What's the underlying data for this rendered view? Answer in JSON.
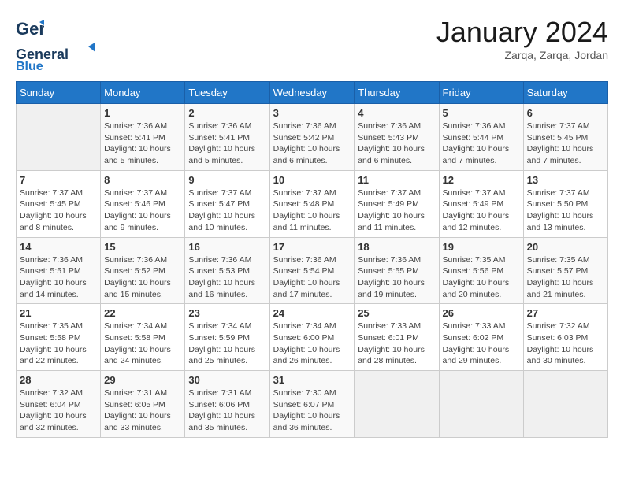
{
  "header": {
    "logo_line1": "General",
    "logo_line2": "Blue",
    "month_title": "January 2024",
    "location": "Zarqa, Zarqa, Jordan"
  },
  "weekdays": [
    "Sunday",
    "Monday",
    "Tuesday",
    "Wednesday",
    "Thursday",
    "Friday",
    "Saturday"
  ],
  "weeks": [
    [
      {
        "day": "",
        "info": ""
      },
      {
        "day": "1",
        "info": "Sunrise: 7:36 AM\nSunset: 5:41 PM\nDaylight: 10 hours\nand 5 minutes."
      },
      {
        "day": "2",
        "info": "Sunrise: 7:36 AM\nSunset: 5:41 PM\nDaylight: 10 hours\nand 5 minutes."
      },
      {
        "day": "3",
        "info": "Sunrise: 7:36 AM\nSunset: 5:42 PM\nDaylight: 10 hours\nand 6 minutes."
      },
      {
        "day": "4",
        "info": "Sunrise: 7:36 AM\nSunset: 5:43 PM\nDaylight: 10 hours\nand 6 minutes."
      },
      {
        "day": "5",
        "info": "Sunrise: 7:36 AM\nSunset: 5:44 PM\nDaylight: 10 hours\nand 7 minutes."
      },
      {
        "day": "6",
        "info": "Sunrise: 7:37 AM\nSunset: 5:45 PM\nDaylight: 10 hours\nand 7 minutes."
      }
    ],
    [
      {
        "day": "7",
        "info": "Sunrise: 7:37 AM\nSunset: 5:45 PM\nDaylight: 10 hours\nand 8 minutes."
      },
      {
        "day": "8",
        "info": "Sunrise: 7:37 AM\nSunset: 5:46 PM\nDaylight: 10 hours\nand 9 minutes."
      },
      {
        "day": "9",
        "info": "Sunrise: 7:37 AM\nSunset: 5:47 PM\nDaylight: 10 hours\nand 10 minutes."
      },
      {
        "day": "10",
        "info": "Sunrise: 7:37 AM\nSunset: 5:48 PM\nDaylight: 10 hours\nand 11 minutes."
      },
      {
        "day": "11",
        "info": "Sunrise: 7:37 AM\nSunset: 5:49 PM\nDaylight: 10 hours\nand 11 minutes."
      },
      {
        "day": "12",
        "info": "Sunrise: 7:37 AM\nSunset: 5:49 PM\nDaylight: 10 hours\nand 12 minutes."
      },
      {
        "day": "13",
        "info": "Sunrise: 7:37 AM\nSunset: 5:50 PM\nDaylight: 10 hours\nand 13 minutes."
      }
    ],
    [
      {
        "day": "14",
        "info": "Sunrise: 7:36 AM\nSunset: 5:51 PM\nDaylight: 10 hours\nand 14 minutes."
      },
      {
        "day": "15",
        "info": "Sunrise: 7:36 AM\nSunset: 5:52 PM\nDaylight: 10 hours\nand 15 minutes."
      },
      {
        "day": "16",
        "info": "Sunrise: 7:36 AM\nSunset: 5:53 PM\nDaylight: 10 hours\nand 16 minutes."
      },
      {
        "day": "17",
        "info": "Sunrise: 7:36 AM\nSunset: 5:54 PM\nDaylight: 10 hours\nand 17 minutes."
      },
      {
        "day": "18",
        "info": "Sunrise: 7:36 AM\nSunset: 5:55 PM\nDaylight: 10 hours\nand 19 minutes."
      },
      {
        "day": "19",
        "info": "Sunrise: 7:35 AM\nSunset: 5:56 PM\nDaylight: 10 hours\nand 20 minutes."
      },
      {
        "day": "20",
        "info": "Sunrise: 7:35 AM\nSunset: 5:57 PM\nDaylight: 10 hours\nand 21 minutes."
      }
    ],
    [
      {
        "day": "21",
        "info": "Sunrise: 7:35 AM\nSunset: 5:58 PM\nDaylight: 10 hours\nand 22 minutes."
      },
      {
        "day": "22",
        "info": "Sunrise: 7:34 AM\nSunset: 5:58 PM\nDaylight: 10 hours\nand 24 minutes."
      },
      {
        "day": "23",
        "info": "Sunrise: 7:34 AM\nSunset: 5:59 PM\nDaylight: 10 hours\nand 25 minutes."
      },
      {
        "day": "24",
        "info": "Sunrise: 7:34 AM\nSunset: 6:00 PM\nDaylight: 10 hours\nand 26 minutes."
      },
      {
        "day": "25",
        "info": "Sunrise: 7:33 AM\nSunset: 6:01 PM\nDaylight: 10 hours\nand 28 minutes."
      },
      {
        "day": "26",
        "info": "Sunrise: 7:33 AM\nSunset: 6:02 PM\nDaylight: 10 hours\nand 29 minutes."
      },
      {
        "day": "27",
        "info": "Sunrise: 7:32 AM\nSunset: 6:03 PM\nDaylight: 10 hours\nand 30 minutes."
      }
    ],
    [
      {
        "day": "28",
        "info": "Sunrise: 7:32 AM\nSunset: 6:04 PM\nDaylight: 10 hours\nand 32 minutes."
      },
      {
        "day": "29",
        "info": "Sunrise: 7:31 AM\nSunset: 6:05 PM\nDaylight: 10 hours\nand 33 minutes."
      },
      {
        "day": "30",
        "info": "Sunrise: 7:31 AM\nSunset: 6:06 PM\nDaylight: 10 hours\nand 35 minutes."
      },
      {
        "day": "31",
        "info": "Sunrise: 7:30 AM\nSunset: 6:07 PM\nDaylight: 10 hours\nand 36 minutes."
      },
      {
        "day": "",
        "info": ""
      },
      {
        "day": "",
        "info": ""
      },
      {
        "day": "",
        "info": ""
      }
    ]
  ]
}
